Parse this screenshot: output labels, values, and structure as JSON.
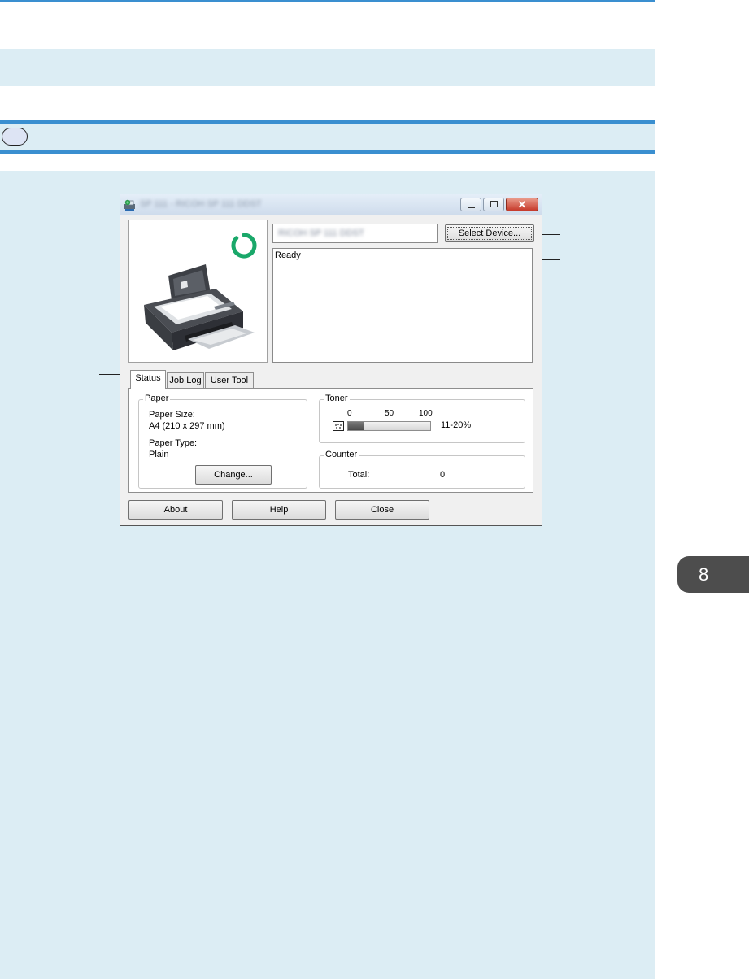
{
  "app": {
    "window_title": "SP 111 - RICOH SP 111 DDST",
    "device_name": "RICOH SP 111 DDST",
    "select_device_label": "Select Device...",
    "status_message": "Ready"
  },
  "tabs": [
    {
      "label": "Status",
      "active": true
    },
    {
      "label": "Job Log",
      "active": false
    },
    {
      "label": "User Tool",
      "active": false
    }
  ],
  "paper": {
    "group_label": "Paper",
    "size_label": "Paper Size:",
    "size_value": "A4 (210 x 297 mm)",
    "type_label": "Paper Type:",
    "type_value": "Plain",
    "change_label": "Change..."
  },
  "toner": {
    "group_label": "Toner",
    "scale_min": "0",
    "scale_mid": "50",
    "scale_max": "100",
    "level_text": "11-20%",
    "level_fraction": 0.2
  },
  "counter": {
    "group_label": "Counter",
    "total_label": "Total:",
    "total_value": "0"
  },
  "buttons": {
    "about": "About",
    "help": "Help",
    "close": "Close"
  },
  "page": {
    "chapter_number": "8"
  },
  "colors": {
    "accent_blue": "#3a8fd0",
    "background_band": "#dcedf4",
    "status_ring": "#1aa86a"
  },
  "icons": {
    "app_icon": "printer-globe-icon",
    "status_ring": "ready-ring-icon",
    "toner_icon": "toner-cartridge-icon"
  }
}
